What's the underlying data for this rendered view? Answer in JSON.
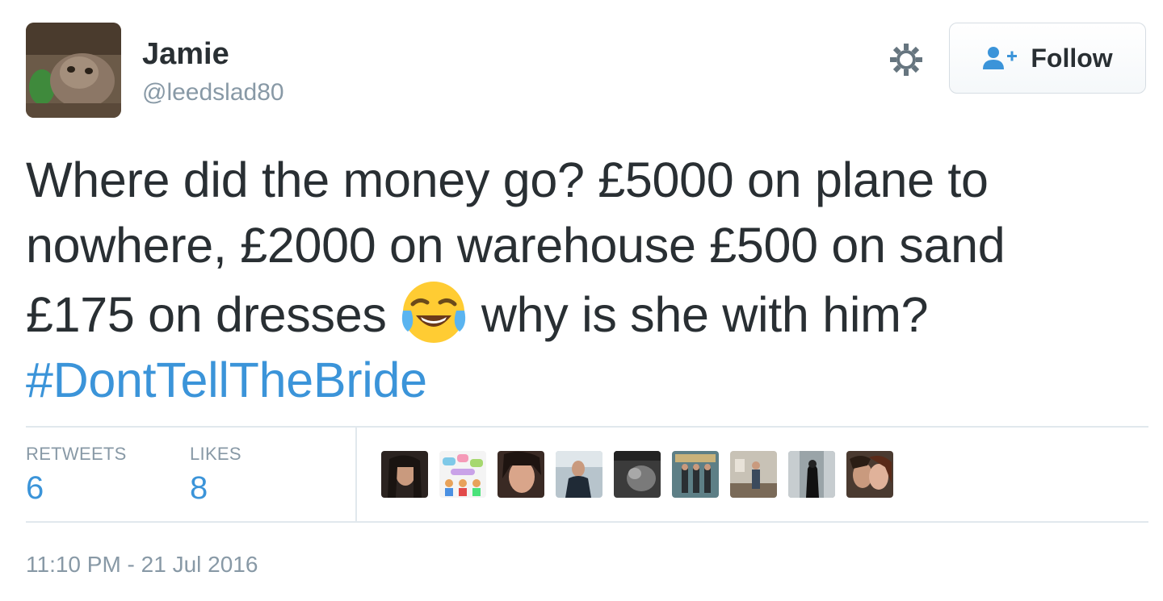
{
  "author": {
    "display_name": "Jamie",
    "handle": "@leedslad80",
    "avatar_icon": "profile-photo"
  },
  "actions": {
    "settings_icon": "gear-icon",
    "follow_label": "Follow",
    "follow_icon": "add-user-icon"
  },
  "tweet": {
    "line1": "Where did the money go? £5000 on plane to",
    "line2": "nowhere, £2000 on warehouse £500 on sand",
    "line3_before_emoji": "£175 on dresses",
    "emoji": "face-with-tears-of-joy",
    "line3_after_emoji": "why is she with him?",
    "hashtag": "#DontTellTheBride"
  },
  "stats": {
    "retweets_label": "RETWEETS",
    "retweets_count": "6",
    "likes_label": "LIKES",
    "likes_count": "8"
  },
  "likers_count": 9,
  "timestamp": "11:10 PM - 21 Jul 2016",
  "colors": {
    "link": "#3b94d9",
    "muted": "#8899a6",
    "text": "#292f33",
    "divider": "#e1e8ed"
  }
}
